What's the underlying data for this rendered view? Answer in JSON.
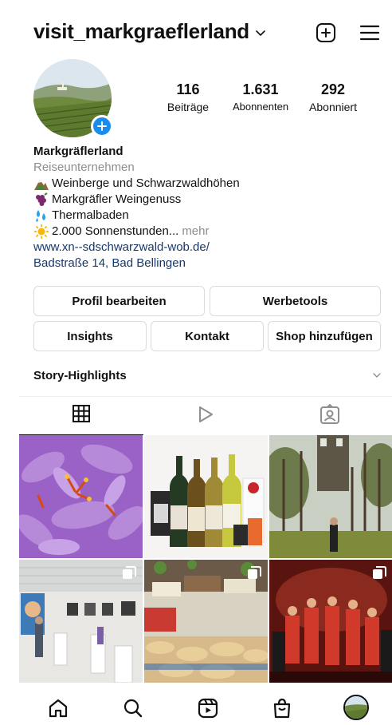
{
  "header": {
    "username": "visit_markgraeflerland",
    "icons": [
      "chevron-down-icon",
      "new-post-icon",
      "menu-icon"
    ]
  },
  "profile": {
    "stats": [
      {
        "value": "116",
        "label": "Beiträge"
      },
      {
        "value": "1.631",
        "label": "Abonnenten"
      },
      {
        "value": "292",
        "label": "Abonniert"
      }
    ],
    "avatar_plus_color": "#1a8cf0"
  },
  "bio": {
    "name": "Markgräflerland",
    "category": "Reiseunternehmen",
    "lines": [
      {
        "emoji": "mountain-vineyard-icon",
        "text": "Weinberge und Schwarzwaldhöhen"
      },
      {
        "emoji": "grapes-icon",
        "text": "Markgräfler Weingenuss"
      },
      {
        "emoji": "water-drops-icon",
        "text": "Thermalbaden"
      },
      {
        "emoji": "sun-icon",
        "text": "2.000 Sonnenstunden..."
      }
    ],
    "more": "mehr",
    "website": "www.xn--sdschwarzwald-wob.de/",
    "address": "Badstraße 14, Bad Bellingen",
    "link_color": "#17386b"
  },
  "buttons": {
    "edit_profile": "Profil bearbeiten",
    "ad_tools": "Werbetools",
    "insights": "Insights",
    "contact": "Kontakt",
    "add_shop": "Shop hinzufügen"
  },
  "highlights": {
    "title": "Story-Highlights"
  },
  "tabs": [
    "grid-icon",
    "reels-icon",
    "tagged-icon"
  ],
  "grid": {
    "posts": [
      "saffron-crocus-photo",
      "wine-bottles-photo",
      "forest-castle-photo",
      "art-exhibition-photo",
      "market-stall-photo",
      "stage-performance-photo"
    ]
  },
  "bottom_nav": [
    "home-icon",
    "search-icon",
    "reels-icon",
    "shop-icon",
    "profile-avatar"
  ]
}
